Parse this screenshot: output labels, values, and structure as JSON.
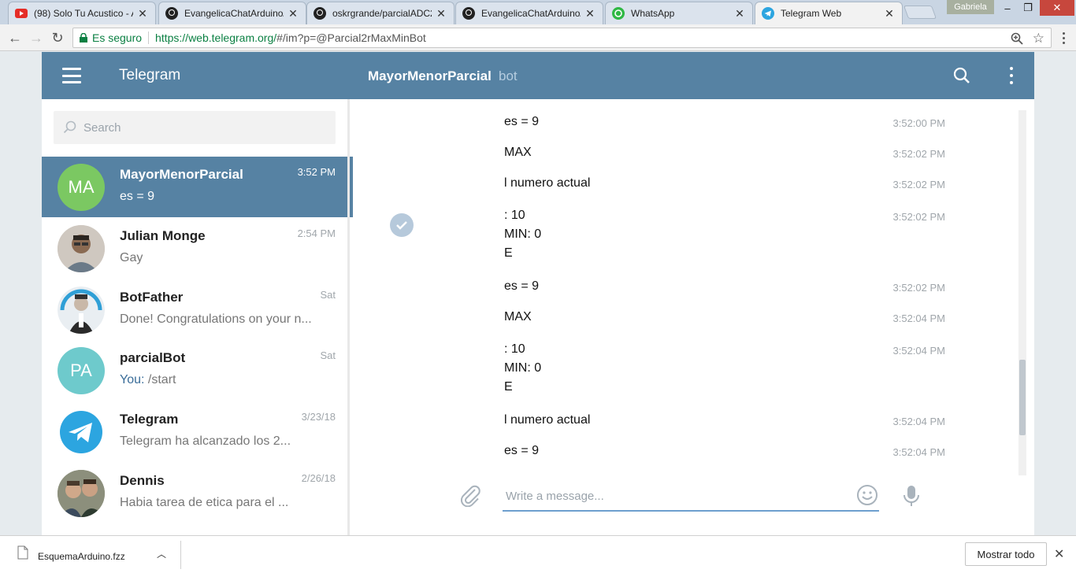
{
  "browser": {
    "tabs": [
      {
        "title": "(98) Solo Tu Acustico - A",
        "icon": "youtube-icon"
      },
      {
        "title": "EvangelicaChatArduino/",
        "icon": "github-icon"
      },
      {
        "title": "oskrgrande/parcialADC2",
        "icon": "github-icon"
      },
      {
        "title": "EvangelicaChatArduino/",
        "icon": "github-icon"
      },
      {
        "title": "WhatsApp",
        "icon": "whatsapp-icon"
      },
      {
        "title": "Telegram Web",
        "icon": "telegram-icon"
      }
    ],
    "profile": "Gabriela",
    "secure_label": "Es seguro",
    "url_scheme_host": "https://web.telegram.org/",
    "url_rest": "#/im?p=@Parcial2rMaxMinBot"
  },
  "header": {
    "app_title": "Telegram",
    "chat_title": "MayorMenorParcial",
    "chat_subtitle": "bot",
    "accent": "#5682a3"
  },
  "search": {
    "placeholder": "Search"
  },
  "dialogs": [
    {
      "initials": "MA",
      "peer": "MayorMenorParcial",
      "date": "3:52 PM",
      "message": "es = 9",
      "avatar_color": "#7bc862",
      "active": true
    },
    {
      "initials": "",
      "peer": "Julian Monge",
      "date": "2:54 PM",
      "message": "Gay",
      "avatar_color": "#6b5a4c"
    },
    {
      "initials": "",
      "peer": "BotFather",
      "date": "Sat",
      "message": "Done! Congratulations on your n...",
      "avatar_color": "#2f9fd6"
    },
    {
      "initials": "PA",
      "peer": "parcialBot",
      "date": "Sat",
      "you_prefix": "You:",
      "message": "/start",
      "avatar_color": "#6ecacc"
    },
    {
      "initials": "",
      "peer": "Telegram",
      "date": "3/23/18",
      "message": "Telegram ha alcanzado los 2...",
      "avatar_color": "#2ca5e0"
    },
    {
      "initials": "",
      "peer": "Dennis",
      "date": "2/26/18",
      "message": "Habia tarea de etica para el ...",
      "avatar_color": "#7f8a6c"
    }
  ],
  "messages": [
    {
      "lines": [
        "es = 9"
      ],
      "time": "3:52:00 PM"
    },
    {
      "lines": [
        "MAX"
      ],
      "time": "3:52:02 PM"
    },
    {
      "lines": [
        "l numero actual"
      ],
      "time": "3:52:02 PM"
    },
    {
      "lines": [
        ": 10",
        "MIN: 0",
        "E"
      ],
      "time": "3:52:02 PM"
    },
    {
      "lines": [
        "es = 9"
      ],
      "time": "3:52:02 PM"
    },
    {
      "lines": [
        "MAX"
      ],
      "time": "3:52:04 PM"
    },
    {
      "lines": [
        ": 10",
        "MIN: 0",
        "E"
      ],
      "time": "3:52:04 PM"
    },
    {
      "lines": [
        "l numero actual"
      ],
      "time": "3:52:04 PM"
    },
    {
      "lines": [
        "es = 9"
      ],
      "time": "3:52:04 PM"
    }
  ],
  "composer": {
    "placeholder": "Write a message..."
  },
  "download": {
    "filename": "EsquemaArduino.fzz",
    "show_all": "Mostrar todo"
  }
}
